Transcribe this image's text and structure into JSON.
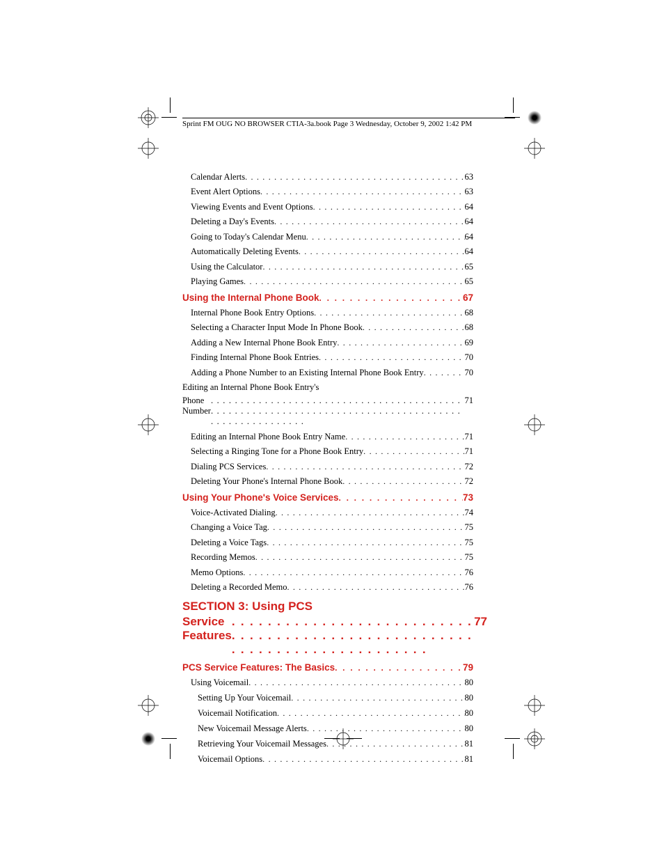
{
  "header": "Sprint FM OUG NO BROWSER CTIA-3a.book  Page 3  Wednesday, October 9, 2002  1:42 PM",
  "entries": [
    {
      "type": "sub",
      "title": "Calendar Alerts",
      "page": "63"
    },
    {
      "type": "sub",
      "title": "Event Alert Options",
      "page": "63"
    },
    {
      "type": "sub",
      "title": "Viewing Events and Event Options",
      "page": "64"
    },
    {
      "type": "sub",
      "title": "Deleting a Day's Events",
      "page": "64"
    },
    {
      "type": "sub",
      "title": "Going to Today's Calendar Menu",
      "page": "64"
    },
    {
      "type": "sub",
      "title": "Automatically Deleting Events",
      "page": "64"
    },
    {
      "type": "sub",
      "title": "Using the Calculator",
      "page": "65"
    },
    {
      "type": "sub",
      "title": "Playing Games",
      "page": "65"
    },
    {
      "type": "chapter",
      "title": "Using the Internal Phone Book",
      "page": "67"
    },
    {
      "type": "sub",
      "title": "Internal Phone Book Entry Options",
      "page": "68"
    },
    {
      "type": "sub",
      "title": "Selecting a Character Input Mode In Phone Book",
      "page": "68"
    },
    {
      "type": "sub",
      "title": "Adding a New Internal Phone Book Entry",
      "page": "69"
    },
    {
      "type": "sub",
      "title": "Finding Internal Phone Book Entries",
      "page": "70"
    },
    {
      "type": "sub",
      "title": "Adding a Phone Number to an Existing Internal Phone Book Entry",
      "page": "70"
    },
    {
      "type": "wrap",
      "title_line1": "Editing an Internal Phone Book Entry's",
      "title_line2": "Phone Number",
      "page": "71"
    },
    {
      "type": "sub",
      "title": "Editing an Internal Phone Book Entry Name",
      "page": "71"
    },
    {
      "type": "sub",
      "title": "Selecting a Ringing Tone for a Phone Book Entry",
      "page": "71"
    },
    {
      "type": "sub",
      "title": "Dialing PCS Services",
      "page": "72"
    },
    {
      "type": "sub",
      "title": "Deleting Your Phone's Internal Phone Book",
      "page": "72"
    },
    {
      "type": "chapter",
      "title": "Using Your Phone's Voice Services",
      "page": "73"
    },
    {
      "type": "sub",
      "title": "Voice-Activated Dialing",
      "page": "74"
    },
    {
      "type": "sub",
      "title": "Changing a Voice Tag",
      "page": "75"
    },
    {
      "type": "sub",
      "title": "Deleting a Voice Tags",
      "page": "75"
    },
    {
      "type": "sub",
      "title": "Recording Memos",
      "page": "75"
    },
    {
      "type": "sub",
      "title": "Memo Options",
      "page": "76"
    },
    {
      "type": "sub",
      "title": "Deleting a Recorded Memo",
      "page": "76"
    },
    {
      "type": "section",
      "title_line1": "SECTION 3: Using PCS",
      "title_line2": "Service Features",
      "page": "77"
    },
    {
      "type": "chapter",
      "title": "PCS Service Features: The Basics",
      "page": "79"
    },
    {
      "type": "sub",
      "title": "Using Voicemail",
      "page": "80"
    },
    {
      "type": "topic",
      "title": "Setting Up Your Voicemail",
      "page": "80"
    },
    {
      "type": "topic",
      "title": "Voicemail Notification",
      "page": "80"
    },
    {
      "type": "topic",
      "title": "New Voicemail Message Alerts",
      "page": "80"
    },
    {
      "type": "topic",
      "title": "Retrieving Your Voicemail Messages",
      "page": "81"
    },
    {
      "type": "topic",
      "title": "Voicemail Options",
      "page": "81"
    }
  ]
}
